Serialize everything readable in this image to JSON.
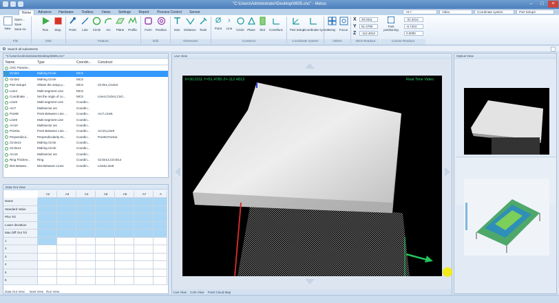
{
  "window": {
    "title": "\"C:\\Users\\Administrator\\Desktop\\0605.cnc\" - Metus"
  },
  "tabs": [
    "Home",
    "Advance",
    "Hardware",
    "Toolbox",
    "Views",
    "Settings",
    "Report",
    "Process Control",
    "Sensor"
  ],
  "ribbon": {
    "file": [
      "Open...",
      "Save",
      "Save As"
    ],
    "file_new": "New",
    "cnc": [
      "Run",
      "Stop"
    ],
    "feature": [
      "Point",
      "Line",
      "Circle",
      "Arc",
      "Plane",
      "Profile"
    ],
    "edit": [
      "Form",
      "Position"
    ],
    "dimension": [
      "Size",
      "Distance",
      "Tools"
    ],
    "construct": [
      "Point",
      "Line",
      "Circle",
      "Plane",
      "Slot",
      "Constfunc"
    ],
    "coordinate": [
      "Part Setup",
      "Coordinate system"
    ],
    "others": [
      "Array",
      "Focus"
    ],
    "groups": [
      "File",
      "CNC",
      "Feature",
      "Edit",
      "Dimension",
      "Construct",
      "Coordinate System",
      "Others",
      "MCS Readout",
      "Course Readout"
    ],
    "mcs": {
      "x": "30.0311",
      "y": "51.4780",
      "z": "-112.4813"
    },
    "mcs_labels": [
      "X",
      "Y",
      "Z"
    ],
    "fast_label": "Fast positioning",
    "course": {
      "a": "-31.2214",
      "b": "-6.7424",
      "c": "0.0000"
    },
    "combos": {
      "c1": "+0.7",
      "c2": "Video",
      "c3": "Coordinate system",
      "c4": "Part Setup3"
    }
  },
  "search": {
    "label": "Search all subinstents"
  },
  "tree": {
    "path": "\"C:\\Users\\Administrator\\Desktop\\0605.cnc\"",
    "headers": [
      "Name",
      "Type",
      "Coordin...",
      "Construct"
    ],
    "rows": [
      {
        "name": "CNC Parame...",
        "type": "",
        "coord": "",
        "cons": ""
      },
      {
        "name": "Circle1",
        "type": "Midring Circle",
        "coord": "MCS",
        "cons": ""
      },
      {
        "name": "Circle2",
        "type": "Midring Circle",
        "coord": "MCS",
        "cons": ""
      },
      {
        "name": "Part Setup3",
        "type": "Obtain the setup p...",
        "coord": "MCS",
        "cons": "Circle1,Circle2"
      },
      {
        "name": "Line4",
        "type": "Multi-segment Line",
        "coord": "MCS",
        "cons": ""
      },
      {
        "name": "Coordinate ...",
        "type": "Set the origin of co...",
        "coord": "MCS",
        "cons": "Line4,Circle1,Circl..."
      },
      {
        "name": "Line5",
        "type": "Multi-segment Line",
        "coord": "Coordin...",
        "cons": ""
      },
      {
        "name": "Arc7",
        "type": "Multisector arc",
        "coord": "Coordin...",
        "cons": ""
      },
      {
        "name": "Point8",
        "type": "Point Between Line ...",
        "coord": "Coordin...",
        "cons": "Arc7,Line6"
      },
      {
        "name": "Line9",
        "type": "Multi-segment Line",
        "coord": "Coordin...",
        "cons": ""
      },
      {
        "name": "Arc10",
        "type": "Multisector arc",
        "coord": "Coordin...",
        "cons": ""
      },
      {
        "name": "Point11",
        "type": "Point Between Line ...",
        "coord": "Coordin...",
        "cons": "Arc10,Line9"
      },
      {
        "name": "Perpendicul...",
        "type": "Perpendicularity Di...",
        "coord": "Coordin...",
        "cons": "Point8,Point11"
      },
      {
        "name": "Circle13",
        "type": "Midring Circle",
        "coord": "Coordin...",
        "cons": ""
      },
      {
        "name": "Circle14",
        "type": "Midring Circle",
        "coord": "Coordin...",
        "cons": ""
      },
      {
        "name": "Arc15",
        "type": "Multisector arc",
        "coord": "Coordin...",
        "cons": ""
      },
      {
        "name": "Ring Thickne...",
        "type": "Ring",
        "coord": "Coordin...",
        "cons": "Circle13,Circle14"
      },
      {
        "name": "Dist Betwee...",
        "type": "Dist Between Lines",
        "coord": "Coordin...",
        "cons": "Line8,Line9"
      }
    ]
  },
  "dataout": {
    "title": "Data Out View",
    "cols": [
      "A2",
      "A3",
      "A4",
      "A5",
      "A6",
      "A7",
      "A"
    ],
    "rows": [
      "Name",
      "Standard Value",
      "Plus Tol",
      "Lower deviation",
      "Max Diff Out Tol",
      "1",
      "2",
      "3",
      "4",
      "5",
      "6"
    ]
  },
  "bottom_tabs": [
    "Data Out View",
    "Nast View",
    "Run View"
  ],
  "view": {
    "title": "Live View",
    "readout": "X=30.0311  Y=51.4780  Z=-112.4813",
    "mode": "Real Time Video",
    "tabs": [
      "Live View",
      "CAD View",
      "Point Cloud Map"
    ]
  },
  "optical": {
    "title": "Optical View"
  },
  "colors": {
    "accent": "#3399ff",
    "green_text": "#2fd26a",
    "grid_blue": "#a9d6f5"
  }
}
